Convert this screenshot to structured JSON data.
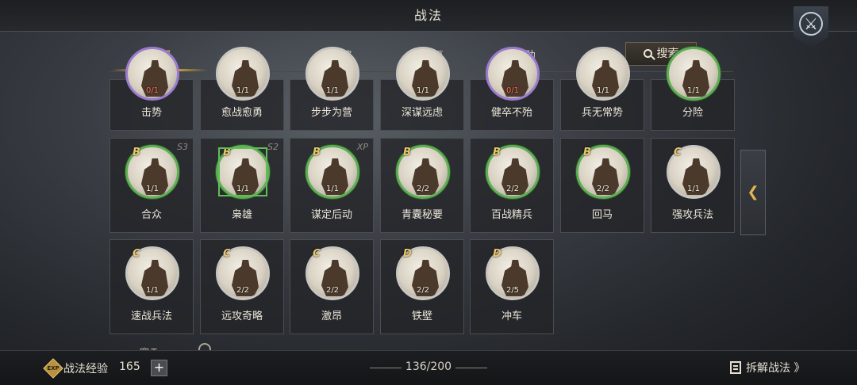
{
  "header": {
    "title": "战法",
    "close_icon": "crossed-swords-icon"
  },
  "tabs": [
    {
      "label": "全部",
      "active": true
    },
    {
      "label": "攻击",
      "active": false
    },
    {
      "label": "谋略",
      "active": false
    },
    {
      "label": "恢复",
      "active": false
    },
    {
      "label": "辅助",
      "active": false
    }
  ],
  "search": {
    "label": "搜索",
    "icon": "search-icon"
  },
  "colors": {
    "accent": "#f0c15a",
    "grade": "#e8c46a",
    "selected": "#5fbf57",
    "count_red": "#ff6b5a"
  },
  "skills_row1": [
    {
      "name": "击势",
      "count": "0/1",
      "count_red": true,
      "ring": "purple"
    },
    {
      "name": "愈战愈勇",
      "count": "1/1",
      "ring": "none"
    },
    {
      "name": "步步为营",
      "count": "1/1",
      "ring": "none"
    },
    {
      "name": "深谋远虑",
      "count": "1/1",
      "ring": "none"
    },
    {
      "name": "健卒不殆",
      "count": "0/1",
      "count_red": true,
      "ring": "purple"
    },
    {
      "name": "兵无常势",
      "count": "1/1",
      "ring": "none"
    },
    {
      "name": "分险",
      "count": "1/1",
      "ring": "green"
    }
  ],
  "skills_row2": [
    {
      "name": "合众",
      "grade": "B",
      "season": "S3",
      "count": "1/1"
    },
    {
      "name": "枭雄",
      "grade": "B",
      "season": "S2",
      "count": "1/1",
      "selected": true
    },
    {
      "name": "谋定后动",
      "grade": "B",
      "season": "XP",
      "count": "1/1"
    },
    {
      "name": "青囊秘要",
      "grade": "B",
      "season": "",
      "count": "2/2"
    },
    {
      "name": "百战精兵",
      "grade": "B",
      "season": "",
      "count": "2/2"
    },
    {
      "name": "回马",
      "grade": "B",
      "season": "",
      "count": "2/2"
    },
    {
      "name": "强攻兵法",
      "grade": "C",
      "season": "",
      "count": "1/1"
    }
  ],
  "skills_row3": [
    {
      "name": "速战兵法",
      "grade": "C",
      "count": "1/1"
    },
    {
      "name": "远攻奇略",
      "grade": "C",
      "count": "2/2"
    },
    {
      "name": "激昂",
      "grade": "C",
      "count": "2/2"
    },
    {
      "name": "铁壁",
      "grade": "D",
      "count": "2/2"
    },
    {
      "name": "冲车",
      "grade": "D",
      "count": "2/5"
    }
  ],
  "side_toggle": {
    "label": "❮",
    "icon": "chevron-left-icon"
  },
  "footer": {
    "xp_label": "战法经验",
    "xp_value": "165",
    "plus_label": "+",
    "count": "136/200",
    "dismantle_label": "拆解战法 》"
  }
}
